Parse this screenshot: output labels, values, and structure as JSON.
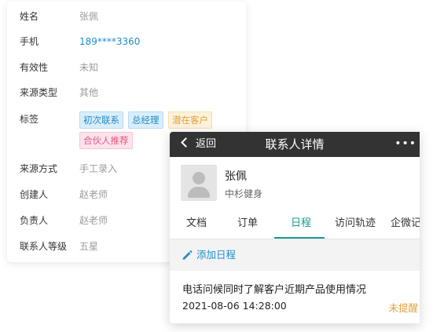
{
  "info": {
    "rows": [
      {
        "label": "姓名",
        "value": "张佩"
      },
      {
        "label": "手机",
        "value": "189****3360"
      },
      {
        "label": "有效性",
        "value": "未知"
      },
      {
        "label": "来源类型",
        "value": "其他"
      },
      {
        "label": "标签",
        "value": ""
      },
      {
        "label": "来源方式",
        "value": "手工录入"
      },
      {
        "label": "创建人",
        "value": "赵老师"
      },
      {
        "label": "负责人",
        "value": "赵老师"
      },
      {
        "label": "联系人等级",
        "value": "五星"
      }
    ],
    "tags": [
      "初次联系",
      "总经理",
      "潜在客户",
      "合伙人推荐"
    ]
  },
  "colors": {
    "nav_bg": "#333333",
    "accent_teal": "#1a9a8f",
    "link_blue": "#1f8fcf",
    "remind_orange": "#e0a23b"
  },
  "phone": {
    "back_label": "返回",
    "title": "联系人详情",
    "more": "•••",
    "contact": {
      "name": "张佩",
      "company": "中杉健身"
    },
    "tabs": [
      "文档",
      "订单",
      "日程",
      "访问轨迹",
      "企微记"
    ],
    "active_tab": "日程",
    "add_schedule": "添加日程",
    "event": {
      "description": "电话问候同时了解客户近期产品使用情况",
      "time": "2021-08-06 14:28:00",
      "status": "未提醒"
    }
  }
}
